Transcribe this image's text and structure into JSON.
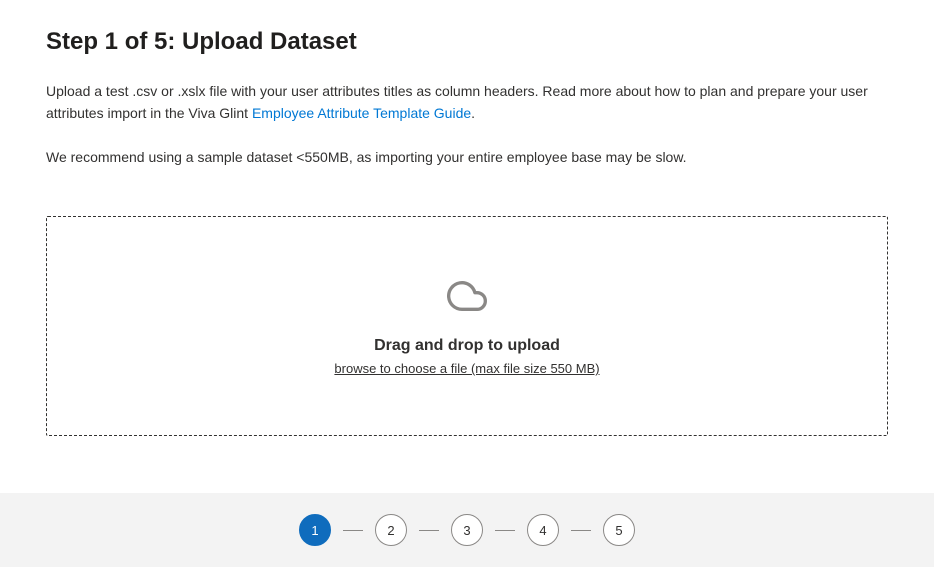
{
  "header": {
    "title": "Step 1 of 5: Upload Dataset"
  },
  "description": {
    "prefix": "Upload a test .csv or .xslx file with your user attributes titles as column headers. Read more about how to plan and prepare your user attributes import in the Viva Glint ",
    "link_text": "Employee Attribute Template Guide",
    "suffix": "."
  },
  "recommendation": "We recommend using a sample dataset <550MB, as importing your entire employee base may be slow.",
  "dropzone": {
    "title": "Drag and drop to upload",
    "subtitle": "browse to choose a file (max file size 550 MB)"
  },
  "stepper": {
    "steps": [
      "1",
      "2",
      "3",
      "4",
      "5"
    ],
    "active_index": 0
  }
}
